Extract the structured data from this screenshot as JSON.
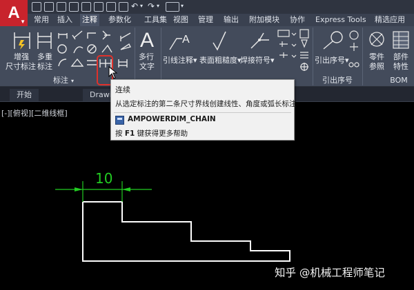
{
  "app": {
    "logo_letter": "A"
  },
  "ribbon_tabs": [
    "常用",
    "插入",
    "注释",
    "参数化",
    "工具集",
    "视图",
    "管理",
    "输出",
    "附加模块",
    "协作",
    "Express Tools",
    "精选应用"
  ],
  "ribbon": {
    "buttons": {
      "enhanced_dim": [
        "增强",
        "尺寸标注"
      ],
      "multi_dim": [
        "多重",
        "标注"
      ],
      "mtext": [
        "多行",
        "文字"
      ],
      "leader_note": "引线注释",
      "surface_roughness": "表面粗糙度",
      "weld_symbol": "焊接符号",
      "balloon": "引出序号",
      "part_ref": [
        "零件",
        "参照"
      ],
      "part_props": [
        "部件",
        "特性"
      ]
    },
    "panels": {
      "dim": "标注",
      "balloon": "引出序号",
      "bom": "BOM"
    }
  },
  "doc_tabs": {
    "start": "开始",
    "drawing": "Drawi"
  },
  "viewport": {
    "label": "[-][俯视][二维线框]"
  },
  "tooltip": {
    "title": "连续",
    "description": "从选定标注的第二条尺寸界线创建线性、角度或弧长标注",
    "command": "AMPOWERDIM_CHAIN",
    "help_key": "F1",
    "help_prefix": "按",
    "help_suffix": "键获得更多帮助"
  },
  "drawing": {
    "dimension_text": "10"
  },
  "watermark": "知乎 @机械工程师笔记",
  "colors": {
    "dimension": "#22cc22",
    "geometry": "#ffffff",
    "highlight": "#e0312b",
    "logo": "#c8232c"
  }
}
